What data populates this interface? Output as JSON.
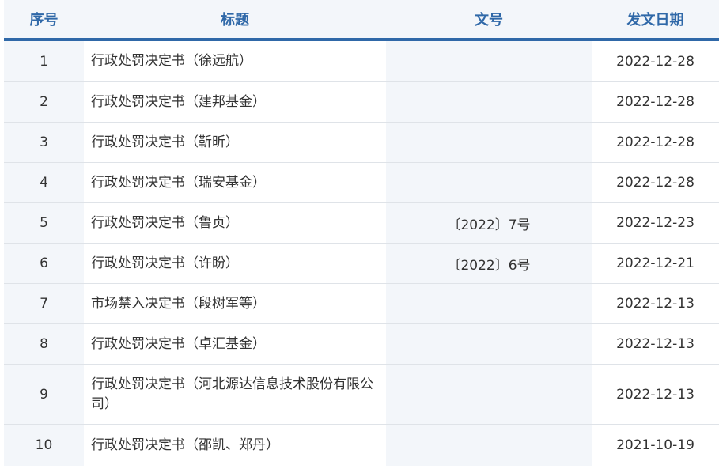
{
  "headers": {
    "no": "序号",
    "title": "标题",
    "doc_no": "文号",
    "date": "发文日期"
  },
  "rows": [
    {
      "no": "1",
      "title": "行政处罚决定书（徐远航）",
      "doc_no": "",
      "date": "2022-12-28"
    },
    {
      "no": "2",
      "title": "行政处罚决定书（建邦基金）",
      "doc_no": "",
      "date": "2022-12-28"
    },
    {
      "no": "3",
      "title": "行政处罚决定书（靳昕）",
      "doc_no": "",
      "date": "2022-12-28"
    },
    {
      "no": "4",
      "title": "行政处罚决定书（瑞安基金）",
      "doc_no": "",
      "date": "2022-12-28"
    },
    {
      "no": "5",
      "title": "行政处罚决定书（鲁贞）",
      "doc_no": "〔2022〕7号",
      "date": "2022-12-23"
    },
    {
      "no": "6",
      "title": "行政处罚决定书（许盼）",
      "doc_no": "〔2022〕6号",
      "date": "2022-12-21"
    },
    {
      "no": "7",
      "title": "市场禁入决定书（段树军等）",
      "doc_no": "",
      "date": "2022-12-13"
    },
    {
      "no": "8",
      "title": "行政处罚决定书（卓汇基金）",
      "doc_no": "",
      "date": "2022-12-13"
    },
    {
      "no": "9",
      "title": "行政处罚决定书（河北源达信息技术股份有限公司）",
      "doc_no": "",
      "date": "2022-12-13"
    },
    {
      "no": "10",
      "title": "行政处罚决定书（邵凯、郑丹）",
      "doc_no": "",
      "date": "2021-10-19"
    }
  ]
}
